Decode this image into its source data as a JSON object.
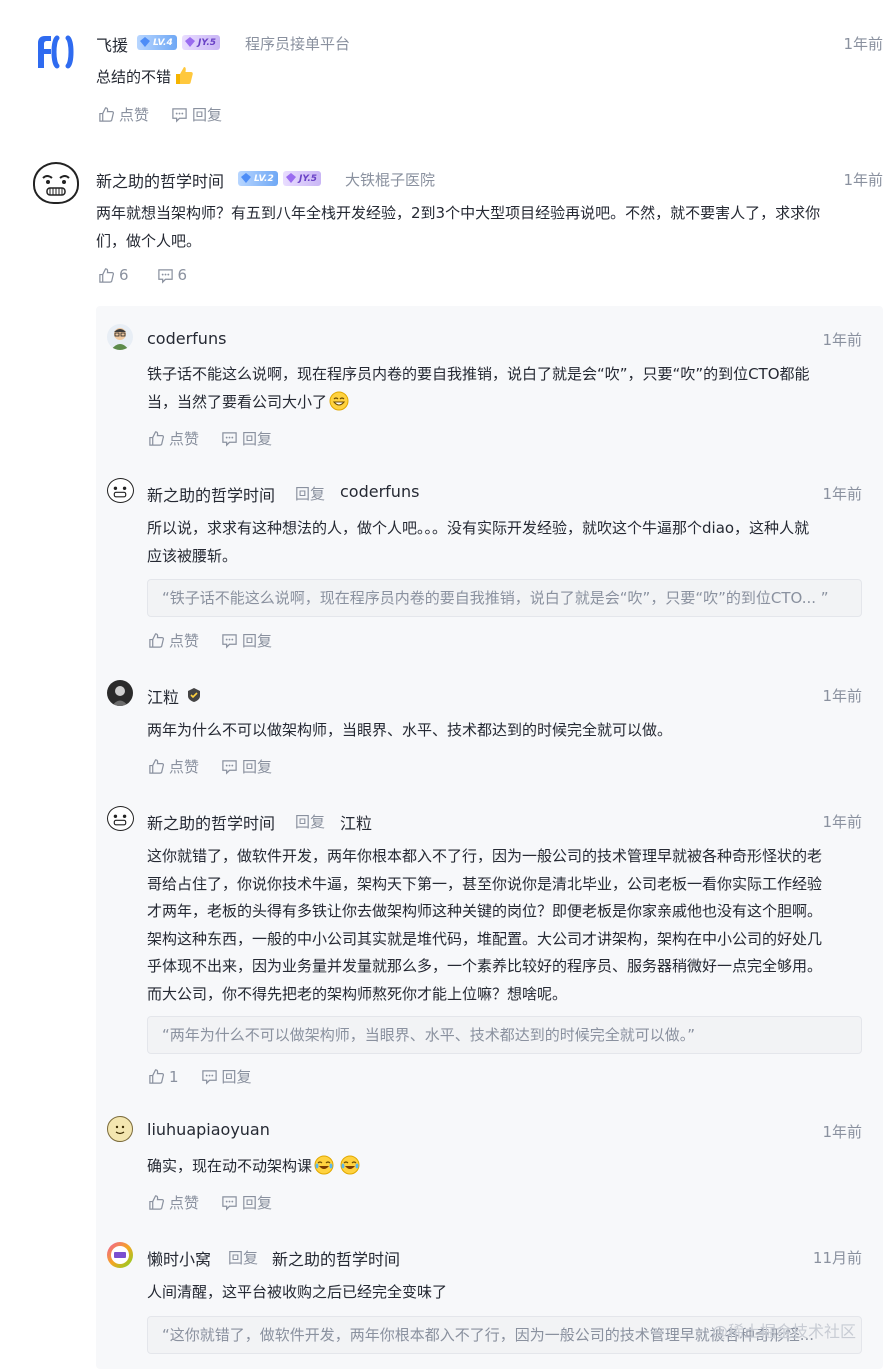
{
  "comments": [
    {
      "name": "飞援",
      "lv": "LV.4",
      "jy": "JY.5",
      "company": "程序员接单平台",
      "time": "1年前",
      "text": "总结的不错",
      "like": "点赞",
      "reply": "回复"
    },
    {
      "name": "新之助的哲学时间",
      "lv": "LV.2",
      "jy": "JY.5",
      "company": "大铁棍子医院",
      "time": "1年前",
      "text_line1": "两年就想当架构师？有五到八年全栈开发经验，2到3个中大型项目经验再说吧。不然，就不要害人了，求求你",
      "text_line2": "们，做个人吧。",
      "like": "6",
      "reply": "6"
    }
  ],
  "replies": [
    {
      "name": "coderfuns",
      "time": "1年前",
      "text_line1": "铁子话不能这么说啊，现在程序员内卷的要自我推销，说白了就是会“吹”，只要“吹”的到位CTO都能",
      "text_line2": "当，当然了要看公司大小了",
      "like": "点赞",
      "reply": "回复"
    },
    {
      "name": "新之助的哲学时间",
      "reply_word": "回复",
      "reply_to": "coderfuns",
      "time": "1年前",
      "text_line1": "所以说，求求有这种想法的人，做个人吧。。。没有实际开发经验，就吹这个牛逼那个diao，这种人就",
      "text_line2": "应该被腰斩。",
      "quote": "“铁子话不能这么说啊，现在程序员内卷的要自我推销，说白了就是会“吹”，只要“吹”的到位CTO... ”",
      "like": "点赞",
      "reply": "回复"
    },
    {
      "name": "江粒",
      "time": "1年前",
      "text": "两年为什么不可以做架构师，当眼界、水平、技术都达到的时候完全就可以做。",
      "like": "点赞",
      "reply": "回复"
    },
    {
      "name": "新之助的哲学时间",
      "reply_word": "回复",
      "reply_to": "江粒",
      "time": "1年前",
      "lines": [
        "这你就错了，做软件开发，两年你根本都入不了行，因为一般公司的技术管理早就被各种奇形怪状的老",
        "哥给占住了，你说你技术牛逼，架构天下第一，甚至你说你是清北毕业，公司老板一看你实际工作经验",
        "才两年，老板的头得有多铁让你去做架构师这种关键的岗位？即便老板是你家亲戚他也没有这个胆啊。",
        "架构这种东西，一般的中小公司其实就是堆代码，堆配置。大公司才讲架构，架构在中小公司的好处几",
        "乎体现不出来，因为业务量并发量就那么多，一个素养比较好的程序员、服务器稍微好一点完全够用。",
        "而大公司，你不得先把老的架构师熬死你才能上位嘛？想啥呢。"
      ],
      "quote": "“两年为什么不可以做架构师，当眼界、水平、技术都达到的时候完全就可以做。”",
      "like": "1",
      "reply": "回复"
    },
    {
      "name": "liuhuapiaoyuan",
      "time": "1年前",
      "text": "确实，现在动不动架构课",
      "like": "点赞",
      "reply": "回复"
    },
    {
      "name": "懒时小窝",
      "reply_word": "回复",
      "reply_to": "新之助的哲学时间",
      "time": "11月前",
      "text": "人间清醒，这平台被收购之后已经完全变味了",
      "quote": "“这你就错了，做软件开发，两年你根本都入不了行，因为一般公司的技术管理早就被各种奇形怪..."
    }
  ],
  "watermark": "@稀土掘金技术社区",
  "colors": {
    "text": "#252933",
    "gray": "#8a919f",
    "reply_bg": "#f7f8fa",
    "quote_bg": "#f2f3f5"
  }
}
